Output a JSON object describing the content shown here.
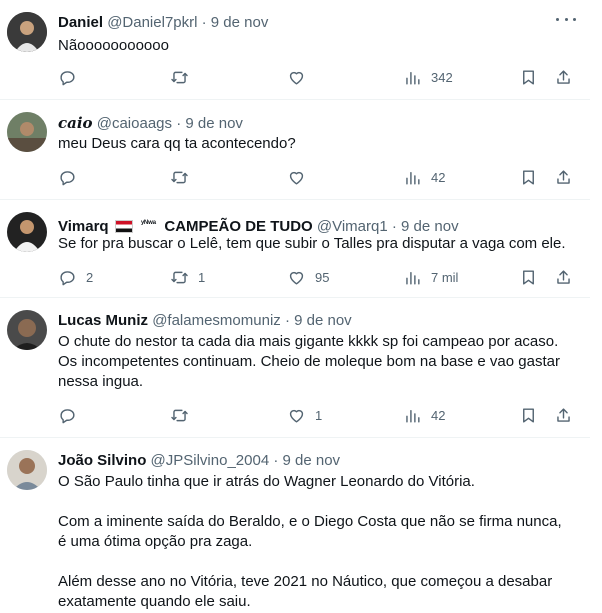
{
  "tweets": [
    {
      "name": "Daniel",
      "handle": "@Daniel7pkrl",
      "sep": "·",
      "date": "9 de nov",
      "lines": [
        "Nãooooooooooo"
      ],
      "replies": "",
      "retweets": "",
      "likes": "",
      "views": "342"
    },
    {
      "name": "caio",
      "handle": "@caioaags",
      "sep": "·",
      "date": "9 de nov",
      "lines": [
        "meu Deus cara qq ta acontecendo?"
      ],
      "replies": "",
      "retweets": "",
      "likes": "",
      "views": "42"
    },
    {
      "name": "Vimarq",
      "name_sup": "ʸᴺʷᵃ",
      "name_suffix": "CAMPEÃO DE TUDO",
      "handle": "@Vimarq1",
      "sep": "·",
      "date": "9 de nov",
      "lines": [
        "Se for pra buscar o Lelê, tem que subir o Talles pra disputar a vaga com ele."
      ],
      "replies": "2",
      "retweets": "1",
      "likes": "95",
      "views": "7 mil"
    },
    {
      "name": "Lucas Muniz",
      "handle": "@falamesmomuniz",
      "sep": "·",
      "date": "9 de nov",
      "lines": [
        "O chute do nestor ta cada dia mais gigante kkkk sp foi campeao por acaso.",
        "Os incompetentes continuam. Cheio de moleque bom na base e vao gastar",
        "nessa ingua."
      ],
      "replies": "",
      "retweets": "",
      "likes": "1",
      "views": "42"
    },
    {
      "name": "João Silvino",
      "handle": "@JPSilvino_2004",
      "sep": "·",
      "date": "9 de nov",
      "paragraphs": [
        [
          "O São Paulo tinha que ir atrás do Wagner Leonardo do Vitória."
        ],
        [
          "Com a iminente saída do Beraldo, e o Diego Costa que não se firma nunca,",
          "é uma ótima opção pra zaga."
        ],
        [
          "Além desse ano no Vitória, teve 2021 no Náutico, que começou a desabar",
          "exatamente quando ele saiu."
        ]
      ]
    }
  ]
}
